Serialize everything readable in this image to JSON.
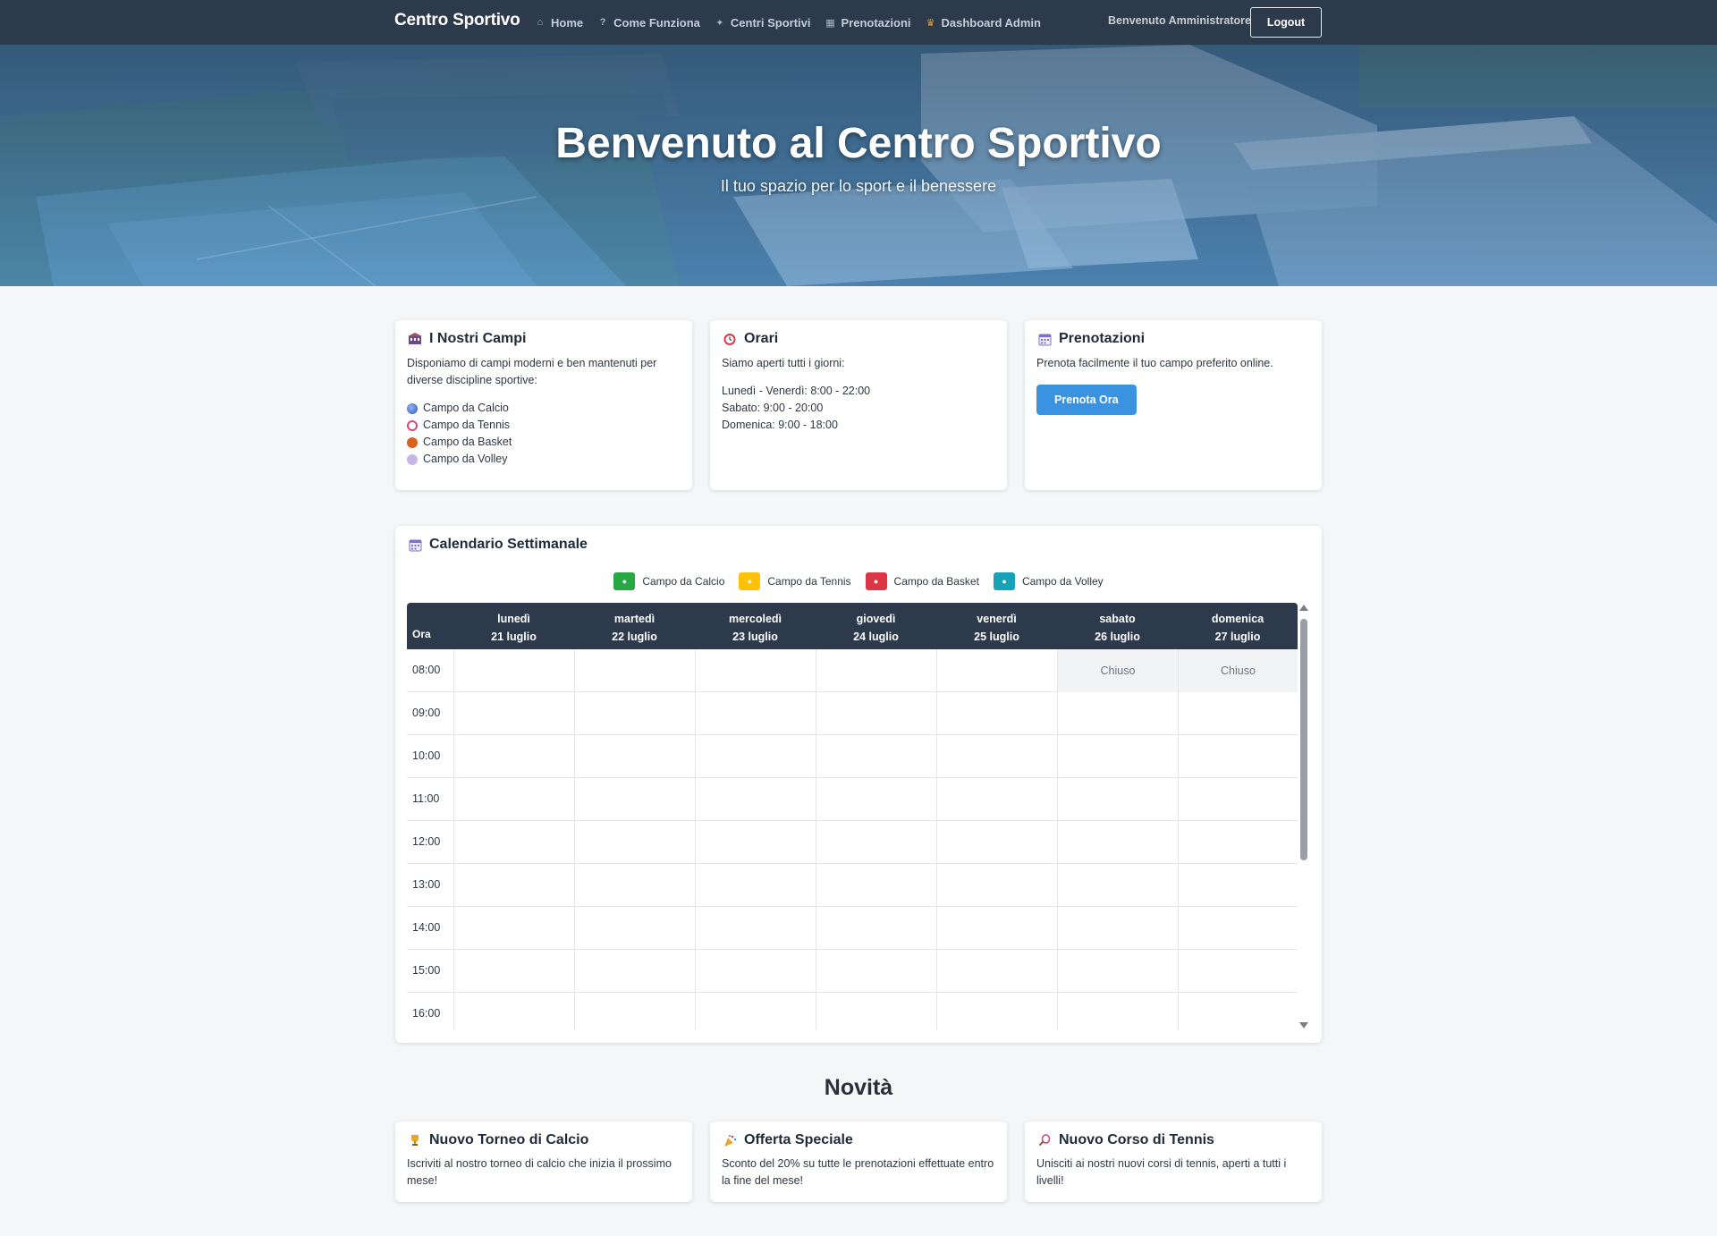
{
  "navbar": {
    "brand": "Centro Sportivo",
    "links": [
      {
        "icon": "house-icon",
        "label": "Home"
      },
      {
        "icon": "question-icon",
        "label": "Come Funziona"
      },
      {
        "icon": "runner-icon",
        "label": "Centri Sportivi"
      },
      {
        "icon": "calendar-icon",
        "label": "Prenotazioni"
      },
      {
        "icon": "crown-icon",
        "label": "Dashboard Admin"
      }
    ],
    "welcome": "Benvenuto Amministratore",
    "logout": "Logout"
  },
  "hero": {
    "title": "Benvenuto al Centro Sportivo",
    "subtitle": "Il tuo spazio per lo sport e il benessere"
  },
  "info_cards": {
    "campi": {
      "icon": "stadium-icon",
      "title": "I Nostri Campi",
      "text": "Disponiamo di campi moderni e ben mantenuti per diverse discipline sportive:",
      "items": [
        {
          "icon": "soccer-ball-icon",
          "label": "Campo da Calcio"
        },
        {
          "icon": "tennis-racket-icon",
          "label": "Campo da Tennis"
        },
        {
          "icon": "basketball-icon",
          "label": "Campo da Basket"
        },
        {
          "icon": "volleyball-icon",
          "label": "Campo da Volley"
        }
      ]
    },
    "orari": {
      "icon": "alarm-clock-icon",
      "title": "Orari",
      "text": "Siamo aperti tutti i giorni:",
      "lines": [
        "Lunedì - Venerdì: 8:00 - 22:00",
        "Sabato: 9:00 - 20:00",
        "Domenica: 9:00 - 18:00"
      ]
    },
    "prenotazioni": {
      "icon": "calendar-icon",
      "title": "Prenotazioni",
      "text": "Prenota facilmente il tuo campo preferito online.",
      "button": "Prenota Ora"
    }
  },
  "calendar": {
    "icon": "calendar-icon",
    "title": "Calendario Settimanale",
    "legend": [
      {
        "label": "Campo da Calcio",
        "color": "#28a745"
      },
      {
        "label": "Campo da Tennis",
        "color": "#ffc107"
      },
      {
        "label": "Campo da Basket",
        "color": "#dc3545"
      },
      {
        "label": "Campo da Volley",
        "color": "#17a2b8"
      }
    ],
    "hour_header": "Ora",
    "days": [
      {
        "day": "lunedì",
        "date": "21 luglio"
      },
      {
        "day": "martedì",
        "date": "22 luglio"
      },
      {
        "day": "mercoledì",
        "date": "23 luglio"
      },
      {
        "day": "giovedì",
        "date": "24 luglio"
      },
      {
        "day": "venerdì",
        "date": "25 luglio"
      },
      {
        "day": "sabato",
        "date": "26 luglio"
      },
      {
        "day": "domenica",
        "date": "27 luglio"
      }
    ],
    "hours": [
      "08:00",
      "09:00",
      "10:00",
      "11:00",
      "12:00",
      "13:00",
      "14:00",
      "15:00",
      "16:00"
    ],
    "closed_label": "Chiuso",
    "closed_slots": [
      {
        "hour": "08:00",
        "day_index": 5
      },
      {
        "hour": "08:00",
        "day_index": 6
      }
    ]
  },
  "news": {
    "section_title": "Novità",
    "cards": [
      {
        "icon": "trophy-icon",
        "title": "Nuovo Torneo di Calcio",
        "text": "Iscriviti al nostro torneo di calcio che inizia il prossimo mese!"
      },
      {
        "icon": "party-popper-icon",
        "title": "Offerta Speciale",
        "text": "Sconto del 20% su tutte le prenotazioni effettuate entro la fine del mese!"
      },
      {
        "icon": "tennis-racket-icon",
        "title": "Nuovo Corso di Tennis",
        "text": "Unisciti ai nostri nuovi corsi di tennis, aperti a tutti i livelli!"
      }
    ]
  }
}
